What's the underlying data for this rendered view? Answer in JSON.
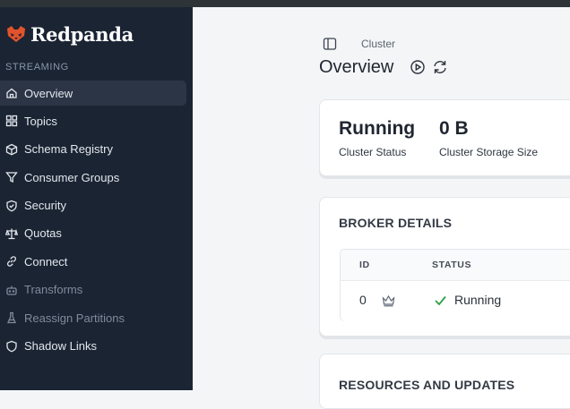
{
  "brand": {
    "name": "Redpanda",
    "accent": "#e2532c"
  },
  "sidebar": {
    "section_label": "STREAMING",
    "items": [
      {
        "label": "Overview",
        "icon": "home-icon",
        "active": true
      },
      {
        "label": "Topics",
        "icon": "grid-icon"
      },
      {
        "label": "Schema Registry",
        "icon": "cube-icon"
      },
      {
        "label": "Consumer Groups",
        "icon": "funnel-icon"
      },
      {
        "label": "Security",
        "icon": "shield-check-icon"
      },
      {
        "label": "Quotas",
        "icon": "scale-icon"
      },
      {
        "label": "Connect",
        "icon": "link-icon"
      },
      {
        "label": "Transforms",
        "icon": "bot-icon",
        "disabled": true
      },
      {
        "label": "Reassign Partitions",
        "icon": "flask-icon",
        "disabled": true
      },
      {
        "label": "Shadow Links",
        "icon": "shield-icon"
      }
    ]
  },
  "header": {
    "breadcrumb": "Cluster",
    "title": "Overview",
    "icons": [
      "panel-toggle-icon",
      "play-circle-icon",
      "refresh-icon"
    ]
  },
  "stats": [
    {
      "value": "Running",
      "label": "Cluster Status"
    },
    {
      "value": "0 B",
      "label": "Cluster Storage Size"
    }
  ],
  "broker_details": {
    "heading": "BROKER DETAILS",
    "columns": [
      "ID",
      "STATUS"
    ],
    "rows": [
      {
        "id": "0",
        "status": "Running",
        "leader_icon": "crown-icon",
        "status_icon": "check-icon"
      }
    ]
  },
  "resources": {
    "heading": "RESOURCES AND UPDATES"
  },
  "colors": {
    "sidebar_bg": "#1a2433",
    "status_ok": "#2f9e44"
  }
}
